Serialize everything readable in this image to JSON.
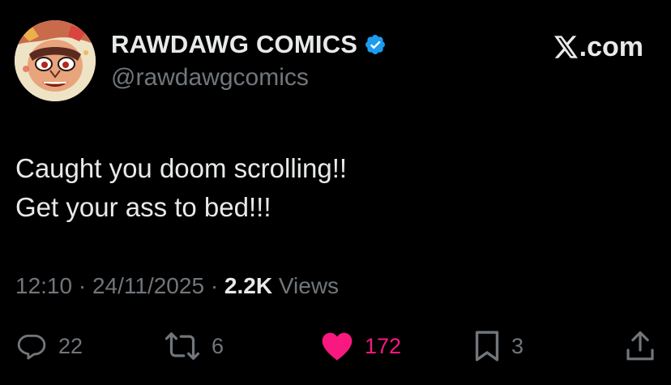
{
  "author": {
    "display_name": "RAWDAWG COMICS",
    "handle": "@rawdawgcomics",
    "verified": true,
    "avatar_icon": "cartoon-face-avatar"
  },
  "brand": {
    "icon": "x-logo-icon",
    "text": ".com"
  },
  "tweet": {
    "text": "Caught you doom scrolling!!\nGet your ass to bed!!!"
  },
  "meta": {
    "time": "12:10",
    "separator": "·",
    "date": "24/11/2025",
    "views_count": "2.2K",
    "views_label": "Views"
  },
  "actions": {
    "reply": {
      "icon": "reply-icon",
      "count": "22"
    },
    "repost": {
      "icon": "repost-icon",
      "count": "6"
    },
    "like": {
      "icon": "heart-icon",
      "count": "172",
      "active": true
    },
    "bookmark": {
      "icon": "bookmark-icon",
      "count": "3"
    },
    "share": {
      "icon": "share-icon"
    }
  },
  "colors": {
    "background": "#000000",
    "primary_text": "#e7e9ea",
    "secondary_text": "#71767b",
    "verified_blue": "#1d9bf0",
    "like_pink": "#f91880"
  }
}
